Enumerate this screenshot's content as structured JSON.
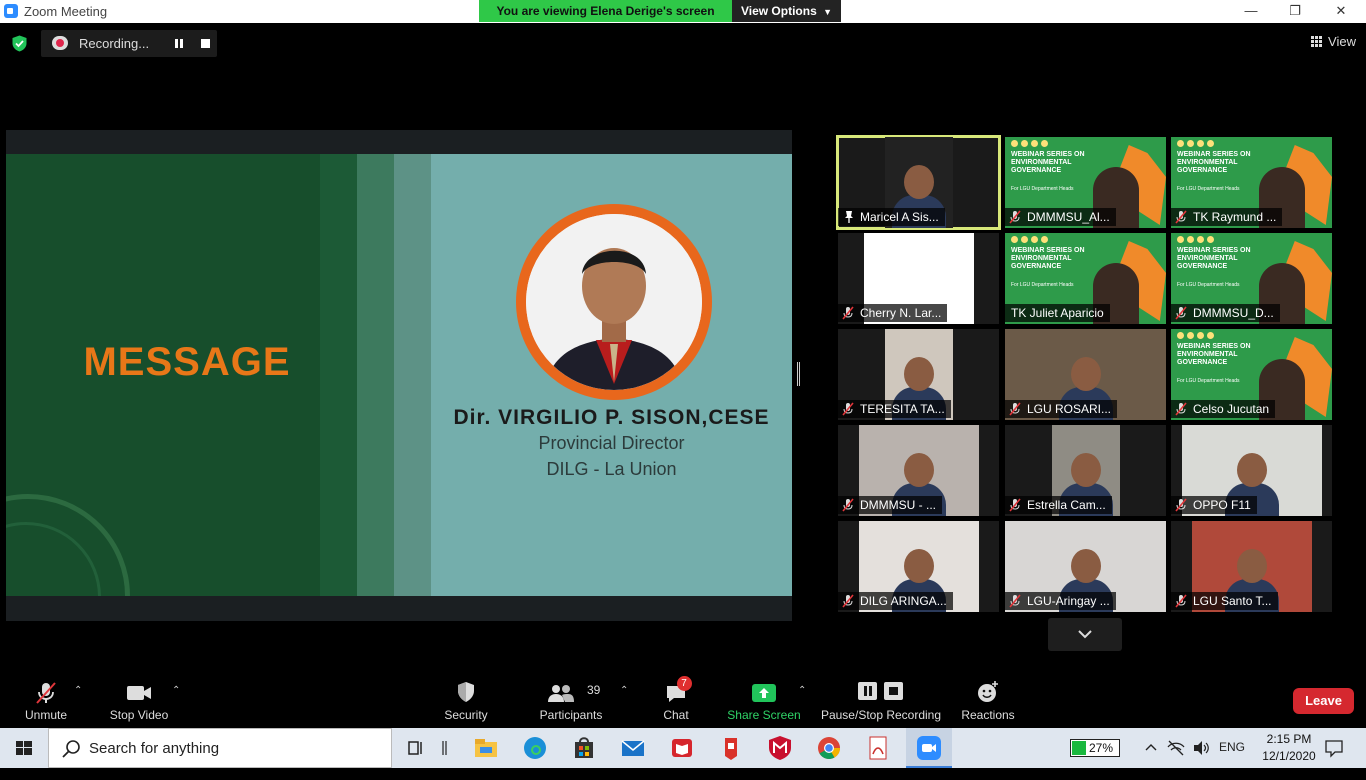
{
  "window": {
    "title": "Zoom Meeting",
    "share_banner": "You are viewing Elena Derige's screen",
    "view_options": "View Options",
    "view_label": "View"
  },
  "recording": {
    "label": "Recording..."
  },
  "slide": {
    "heading": "MESSAGE",
    "speaker_name": "Dir. VIRGILIO P. SISON,CESE",
    "speaker_role": "Provincial Director",
    "speaker_org": "DILG - La Union",
    "colors": {
      "dark_green": "#174e2c",
      "panel": "#74aeac",
      "accent": "#e87718"
    }
  },
  "participants": [
    {
      "name": "Maricel A Sis...",
      "muted": false,
      "pinned": true,
      "bg": "#222"
    },
    {
      "name": "DMMMSU_Al...",
      "muted": true,
      "pinned": false,
      "bg": "webinar"
    },
    {
      "name": "TK Raymund ...",
      "muted": true,
      "pinned": false,
      "bg": "webinar"
    },
    {
      "name": "Cherry N. Lar...",
      "muted": true,
      "pinned": false,
      "bg": "#fff"
    },
    {
      "name": "TK Juliet Aparicio",
      "muted": false,
      "pinned": false,
      "bg": "webinar"
    },
    {
      "name": "DMMMSU_D...",
      "muted": true,
      "pinned": false,
      "bg": "webinar"
    },
    {
      "name": "TERESITA TA...",
      "muted": true,
      "pinned": false,
      "bg": "#cfc7bd"
    },
    {
      "name": "LGU ROSARI...",
      "muted": true,
      "pinned": false,
      "bg": "#6b5a48"
    },
    {
      "name": "Celso Jucutan",
      "muted": true,
      "pinned": false,
      "bg": "webinar"
    },
    {
      "name": "DMMMSU - ...",
      "muted": true,
      "pinned": false,
      "bg": "#b9b2ad"
    },
    {
      "name": "Estrella Cam...",
      "muted": true,
      "pinned": false,
      "bg": "#8f8c84"
    },
    {
      "name": "OPPO F11",
      "muted": true,
      "pinned": false,
      "bg": "#d9dad6"
    },
    {
      "name": "DILG ARINGA...",
      "muted": true,
      "pinned": false,
      "bg": "#e4e0dc"
    },
    {
      "name": "LGU-Aringay ...",
      "muted": true,
      "pinned": false,
      "bg": "#d8d6d4"
    },
    {
      "name": "LGU Santo T...",
      "muted": true,
      "pinned": false,
      "bg": "#b0493a"
    }
  ],
  "webinar_text": "WEBINAR SERIES ON ENVIRONMENTAL GOVERNANCE",
  "webinar_sub": "For LGU Department Heads",
  "toolbar": {
    "unmute": "Unmute",
    "stop_video": "Stop Video",
    "security": "Security",
    "participants": "Participants",
    "participants_count": "39",
    "chat": "Chat",
    "chat_badge": "7",
    "share_screen": "Share Screen",
    "pause_stop_recording": "Pause/Stop Recording",
    "reactions": "Reactions",
    "leave": "Leave"
  },
  "taskbar": {
    "search_placeholder": "Search for anything",
    "battery": "27%",
    "language": "ENG",
    "time": "2:15 PM",
    "date": "12/1/2020"
  }
}
